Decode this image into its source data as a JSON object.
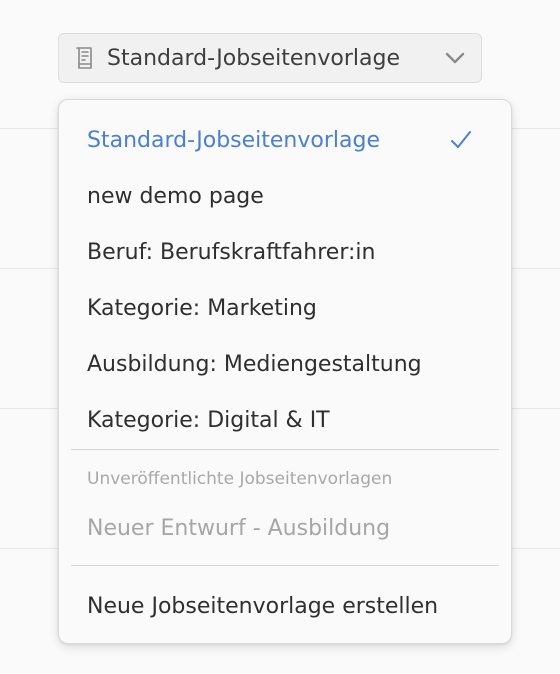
{
  "selector": {
    "label": "Standard-Jobseitenvorlage",
    "icon": "document-template-icon"
  },
  "dropdown": {
    "items": [
      {
        "label": "Standard-Jobseitenvorlage",
        "selected": true
      },
      {
        "label": "new demo page"
      },
      {
        "label": "Beruf: Berufskraftfahrer:in"
      },
      {
        "label": "Kategorie: Marketing"
      },
      {
        "label": "Ausbildung: Mediengestaltung"
      },
      {
        "label": "Kategorie: Digital & IT"
      }
    ],
    "unpublished_header": "Unveröffentlichte Jobseitenvorlagen",
    "unpublished_items": [
      {
        "label": "Neuer Entwurf - Ausbildung"
      }
    ],
    "create_label": "Neue Jobseitenvorlage erstellen"
  },
  "colors": {
    "accent": "#4a7fd6",
    "text": "#2f2f2f",
    "muted": "#a6a6a6"
  }
}
